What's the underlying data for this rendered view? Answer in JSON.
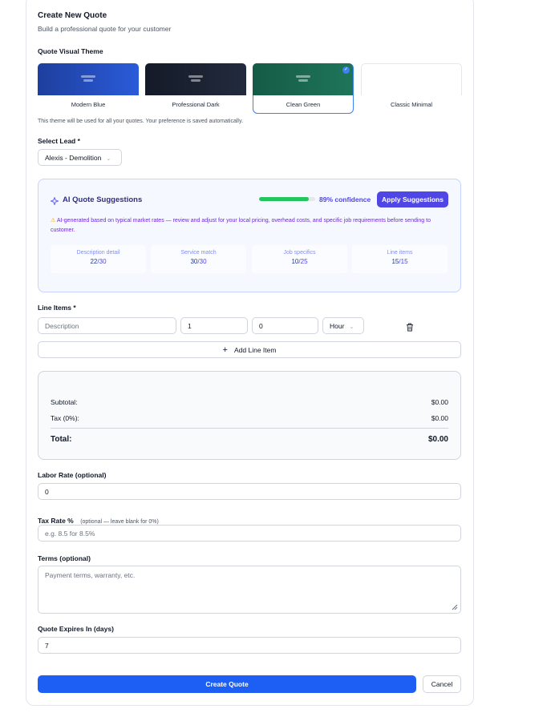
{
  "header": {
    "title": "Create New Quote",
    "subtitle": "Build a professional quote for your customer"
  },
  "theme_section": {
    "label": "Quote Visual Theme",
    "themes": [
      {
        "name": "Modern Blue",
        "color": "#2451c4"
      },
      {
        "name": "Professional Dark",
        "color": "#1e2535"
      },
      {
        "name": "Clean Green",
        "color": "#1d6b53"
      },
      {
        "name": "Classic Minimal",
        "color": "#ffffff"
      }
    ],
    "selected": "Clean Green",
    "selected_icon": "check-icon",
    "hint": "This theme will be used for all your quotes. Your preference is saved automatically."
  },
  "lead": {
    "label": "Select Lead *",
    "value": "Alexis - Demolition",
    "icon": "chevron-down-icon"
  },
  "ai": {
    "icon": "sparkle-icon",
    "title": "AI Quote Suggestions",
    "confidence_pct": 89,
    "confidence_label": "89% confidence",
    "apply_label": "Apply Suggestions",
    "warning_icon": "warning-icon",
    "note": "AI-generated based on typical market rates — review and adjust for your local pricing, overhead costs, and specific job requirements before sending to customer.",
    "metrics": [
      {
        "label": "Description detail",
        "value": "22",
        "max": "/30"
      },
      {
        "label": "Service match",
        "value": "30",
        "max": "/30"
      },
      {
        "label": "Job specifics",
        "value": "10",
        "max": "/25"
      },
      {
        "label": "Line items",
        "value": "15",
        "max": "/15"
      }
    ]
  },
  "line_items": {
    "label": "Line Items *",
    "description_placeholder": "Description",
    "quantity": "1",
    "rate": "0",
    "unit": "Hour",
    "delete_icon": "trash-icon",
    "add_label": "Add Line Item",
    "add_icon": "plus-icon"
  },
  "totals": {
    "subtotal_label": "Subtotal:",
    "subtotal_value": "$0.00",
    "tax_label": "Tax (0%):",
    "tax_value": "$0.00",
    "total_label": "Total:",
    "total_value": "$0.00"
  },
  "labor": {
    "label": "Labor Rate (optional)",
    "value": "0"
  },
  "tax_rate": {
    "label": "Tax Rate %",
    "hint": "(optional — leave blank for 0%)",
    "placeholder": "e.g. 8.5 for 8.5%"
  },
  "terms": {
    "label": "Terms (optional)",
    "placeholder": "Payment terms, warranty, etc."
  },
  "expires": {
    "label": "Quote Expires In (days)",
    "value": "7"
  },
  "actions": {
    "create_label": "Create Quote",
    "cancel_label": "Cancel"
  }
}
